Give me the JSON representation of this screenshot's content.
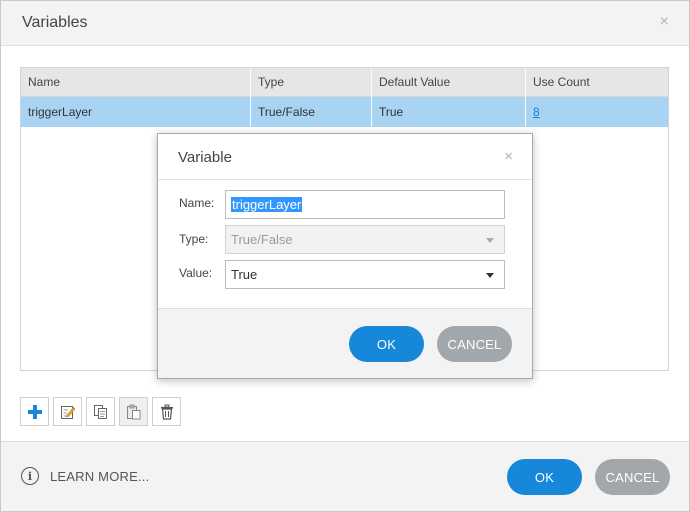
{
  "window": {
    "title": "Variables",
    "close_glyph": "×"
  },
  "table": {
    "columns": [
      "Name",
      "Type",
      "Default Value",
      "Use Count"
    ],
    "rows": [
      {
        "name": "triggerLayer",
        "type": "True/False",
        "default_value": "True",
        "use_count": "8",
        "selected": true
      }
    ]
  },
  "toolbar": {
    "buttons": [
      {
        "icon": "plus-icon",
        "label": "add"
      },
      {
        "icon": "edit-icon",
        "label": "edit"
      },
      {
        "icon": "copy-icon",
        "label": "copy"
      },
      {
        "icon": "paste-icon",
        "label": "paste"
      },
      {
        "icon": "trash-icon",
        "label": "delete"
      }
    ]
  },
  "footer": {
    "learn_more": "LEARN MORE...",
    "info_glyph": "i",
    "ok_label": "OK",
    "cancel_label": "CANCEL"
  },
  "dialog": {
    "title": "Variable",
    "close_glyph": "×",
    "name_label": "Name:",
    "name_value": "triggerLayer",
    "type_label": "Type:",
    "type_value": "True/False",
    "value_label": "Value:",
    "value_value": "True",
    "ok_label": "OK",
    "cancel_label": "CANCEL"
  },
  "colors": {
    "primary": "#1787d9",
    "secondary": "#a2a7ac",
    "selected_row": "#a9d3f2",
    "link": "#1c7fd6"
  }
}
